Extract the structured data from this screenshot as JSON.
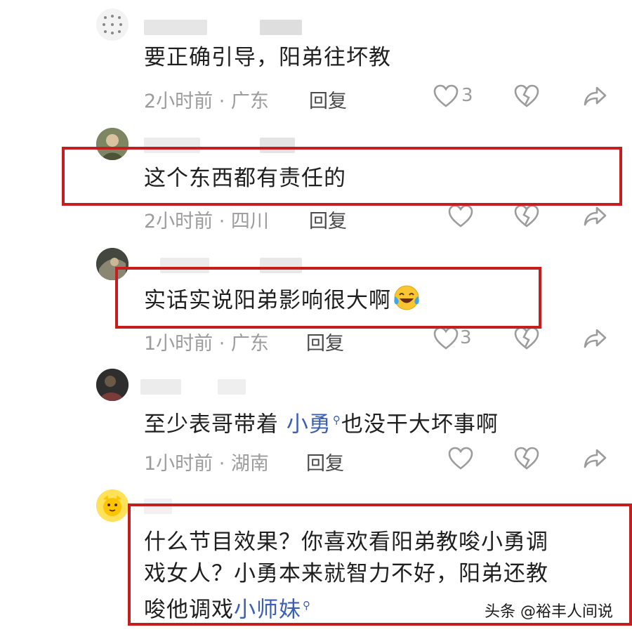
{
  "comments": [
    {
      "text": "要正确引导，阳弟往坏教",
      "meta": "2小时前 · 广东",
      "reply": "回复",
      "likes": "3"
    },
    {
      "text": "这个东西都有责任的",
      "meta": "2小时前 · 四川",
      "reply": "回复",
      "likes": ""
    },
    {
      "text": "实话实说阳弟影响很大啊",
      "meta": "1小时前 · 广东",
      "reply": "回复",
      "likes": "3",
      "emoji": "laughing-crying-emoji"
    },
    {
      "text_before": "至少表哥带着",
      "link": "小勇",
      "text_after": "也没干大坏事啊",
      "meta": "1小时前 · 湖南",
      "reply": "回复",
      "likes": ""
    },
    {
      "line1": "什么节目效果？你喜欢看阳弟教唆小勇调",
      "line2": "戏女人？小勇本来就智力不好，阳弟还教",
      "line3_before": "唆他调戏",
      "link": "小师妹"
    }
  ],
  "icons": {
    "like": "heart-outline-icon",
    "dislike": "broken-heart-icon",
    "share": "share-arrow-icon",
    "search": "search-icon"
  },
  "highlight_color": "#c41e1e",
  "link_color": "#3d5fb3",
  "watermark": "头条 @裕丰人间说"
}
